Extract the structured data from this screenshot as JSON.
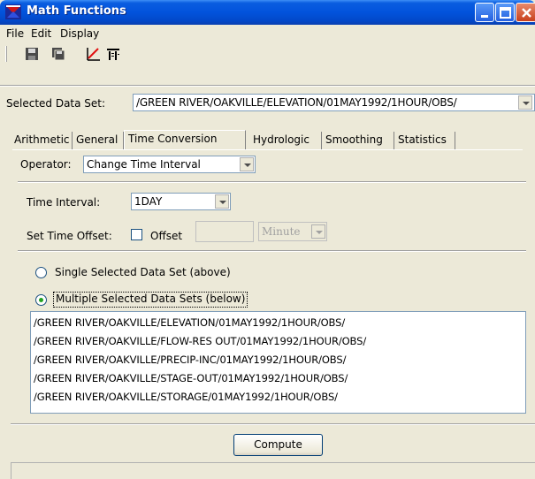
{
  "window": {
    "title": "Math Functions",
    "title_color": "#0253dc"
  },
  "menu": [
    "File",
    "Edit",
    "Display"
  ],
  "toolbar": {
    "icons": [
      "save-icon",
      "save-as-icon",
      "plot-icon",
      "tabulate-icon"
    ]
  },
  "dataset": {
    "label": "Selected Data Set:",
    "value": "/GREEN RIVER/OAKVILLE/ELEVATION/01MAY1992/1HOUR/OBS/"
  },
  "tabs": [
    "Arithmetic",
    "General",
    "Time Conversion",
    "Hydrologic",
    "Smoothing",
    "Statistics"
  ],
  "active_tab": "Time Conversion",
  "operator": {
    "label": "Operator:",
    "value": "Change Time Interval"
  },
  "time_interval": {
    "label": "Time Interval:",
    "value": "1DAY"
  },
  "time_offset": {
    "label": "Set Time Offset:",
    "offset_label": "Offset",
    "offset_value": "",
    "unit": "Minute",
    "checked": false
  },
  "selection": {
    "single_label": "Single Selected Data Set (above)",
    "multiple_label": "Multiple Selected Data Sets (below)",
    "selected": "multiple"
  },
  "datasets": [
    "/GREEN RIVER/OAKVILLE/ELEVATION/01MAY1992/1HOUR/OBS/",
    "/GREEN RIVER/OAKVILLE/FLOW-RES OUT/01MAY1992/1HOUR/OBS/",
    "/GREEN RIVER/OAKVILLE/PRECIP-INC/01MAY1992/1HOUR/OBS/",
    "/GREEN RIVER/OAKVILLE/STAGE-OUT/01MAY1992/1HOUR/OBS/",
    "/GREEN RIVER/OAKVILLE/STORAGE/01MAY1992/1HOUR/OBS/"
  ],
  "compute_label": "Compute"
}
